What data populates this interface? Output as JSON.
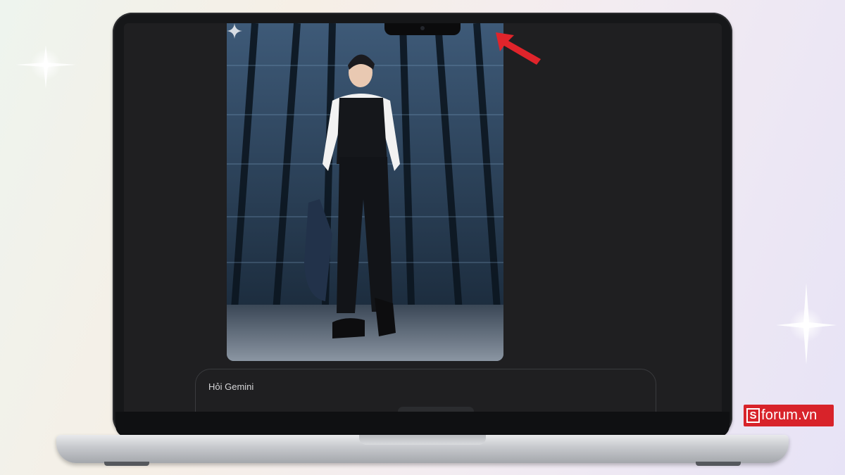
{
  "chat": {
    "input_placeholder": "Hỏi Gemini"
  },
  "generated_image": {
    "badge_icon": "gemini-sparkle-icon"
  },
  "annotation": {
    "arrow_color": "#e0242b",
    "arrow_icon": "arrow-pointing-up-left-icon"
  },
  "watermark": {
    "brand_mark": "S",
    "brand_text": "forum.vn",
    "color": "#d8232a"
  },
  "theme": {
    "screen_bg": "#1f1f21",
    "input_border": "#3a3b3e"
  }
}
